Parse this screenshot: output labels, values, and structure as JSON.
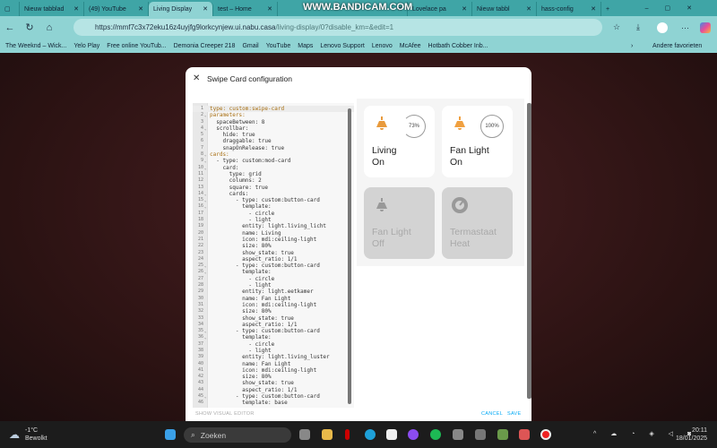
{
  "browser": {
    "tabs": [
      {
        "label": "Nieuw tabblad"
      },
      {
        "label": "(49) YouTube"
      },
      {
        "label": "Living Display",
        "active": true
      },
      {
        "label": "test – Home"
      },
      {
        "label": ""
      },
      {
        "label": "Lovelace pa"
      },
      {
        "label": "Nieuw tabbl"
      },
      {
        "label": "hass-config"
      }
    ],
    "watermark": "WWW.BANDICAM.COM",
    "url_main": "https://mmf7c3x72eku16z4uyjfg9lorkcynjew.ui.nabu.casa",
    "url_path": "/living-display/0?disable_km=&edit=1",
    "bookmarks": [
      "The Weeknd – Wick...",
      "Yelo Play",
      "Free online YouTub...",
      "Demonia Creeper 218",
      "Gmail",
      "YouTube",
      "Maps",
      "Lenovo Support",
      "Lenovo",
      "McAfee",
      "Hotbath Cobber Inb..."
    ],
    "other_favorites": "Andere favorieten"
  },
  "dialog": {
    "title": "Swipe Card configuration",
    "code": [
      "type: custom:swipe-card",
      "parameters:",
      "  spaceBetween: 8",
      "  scrollbar:",
      "    hide: true",
      "    draggable: true",
      "    snapOnRelease: true",
      "cards:",
      "  - type: custom:mod-card",
      "    card:",
      "      type: grid",
      "      columns: 2",
      "      square: true",
      "      cards:",
      "        - type: custom:button-card",
      "          template:",
      "            - circle",
      "            - light",
      "          entity: light.living_licht",
      "          name: Living",
      "          icon: mdi:ceiling-light",
      "          size: 80%",
      "          show_state: true",
      "          aspect_ratio: 1/1",
      "        - type: custom:button-card",
      "          template:",
      "            - circle",
      "            - light",
      "          entity: light.eetkamer",
      "          name: Fan Light",
      "          icon: mdi:ceiling-light",
      "          size: 80%",
      "          show_state: true",
      "          aspect_ratio: 1/1",
      "        - type: custom:button-card",
      "          template:",
      "            - circle",
      "            - light",
      "          entity: light.living_luster",
      "          name: Fan Light",
      "          icon: mdi:ceiling-light",
      "          size: 80%",
      "          show_state: true",
      "          aspect_ratio: 1/1",
      "        - type: custom:button-card",
      "          template: base"
    ],
    "fold_lines": [
      2,
      4,
      8,
      9,
      10,
      14,
      15,
      16,
      25,
      26,
      35,
      36,
      45
    ],
    "cards": [
      {
        "name": "Living",
        "state": "On",
        "brightness": "73%",
        "brightness_value": 73,
        "on": true
      },
      {
        "name": "Fan Light",
        "state": "On",
        "brightness": "100%",
        "brightness_value": 100,
        "on": true
      },
      {
        "name": "Fan Light",
        "state": "Off",
        "on": false
      },
      {
        "name": "Termastaat",
        "state": "Heat",
        "on": false
      }
    ],
    "show_visual_editor": "SHOW VISUAL EDITOR",
    "cancel": "CANCEL",
    "save": "SAVE",
    "accent": "#03a9f4"
  },
  "taskbar": {
    "weather_temp": "-1°C",
    "weather_desc": "Bewolkt",
    "search": "Zoeken",
    "time": "20:11",
    "date": "18/01/2025"
  }
}
